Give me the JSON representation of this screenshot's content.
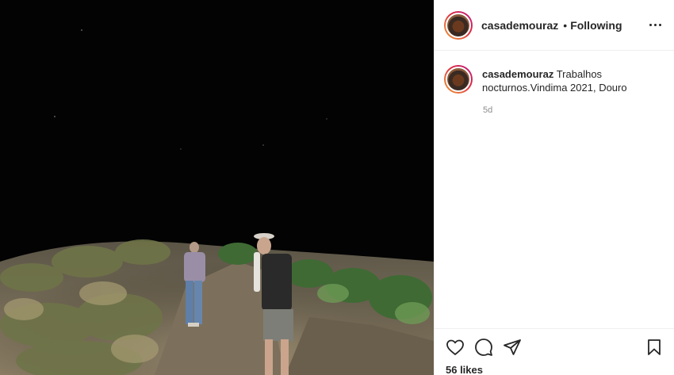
{
  "post": {
    "username": "casademouraz",
    "separator": "•",
    "follow_status": "Following",
    "caption_user": "casademouraz",
    "caption_text": "Trabalhos nocturnos.Vindima 2021, Douro",
    "age": "5d",
    "likes": "56 likes"
  },
  "icons": {
    "more": "more-options-icon",
    "like": "heart-icon",
    "comment": "comment-icon",
    "share": "paper-plane-icon",
    "save": "bookmark-icon"
  },
  "colors": {
    "text": "#262626",
    "muted": "#8e8e8e",
    "border": "#efefef"
  }
}
